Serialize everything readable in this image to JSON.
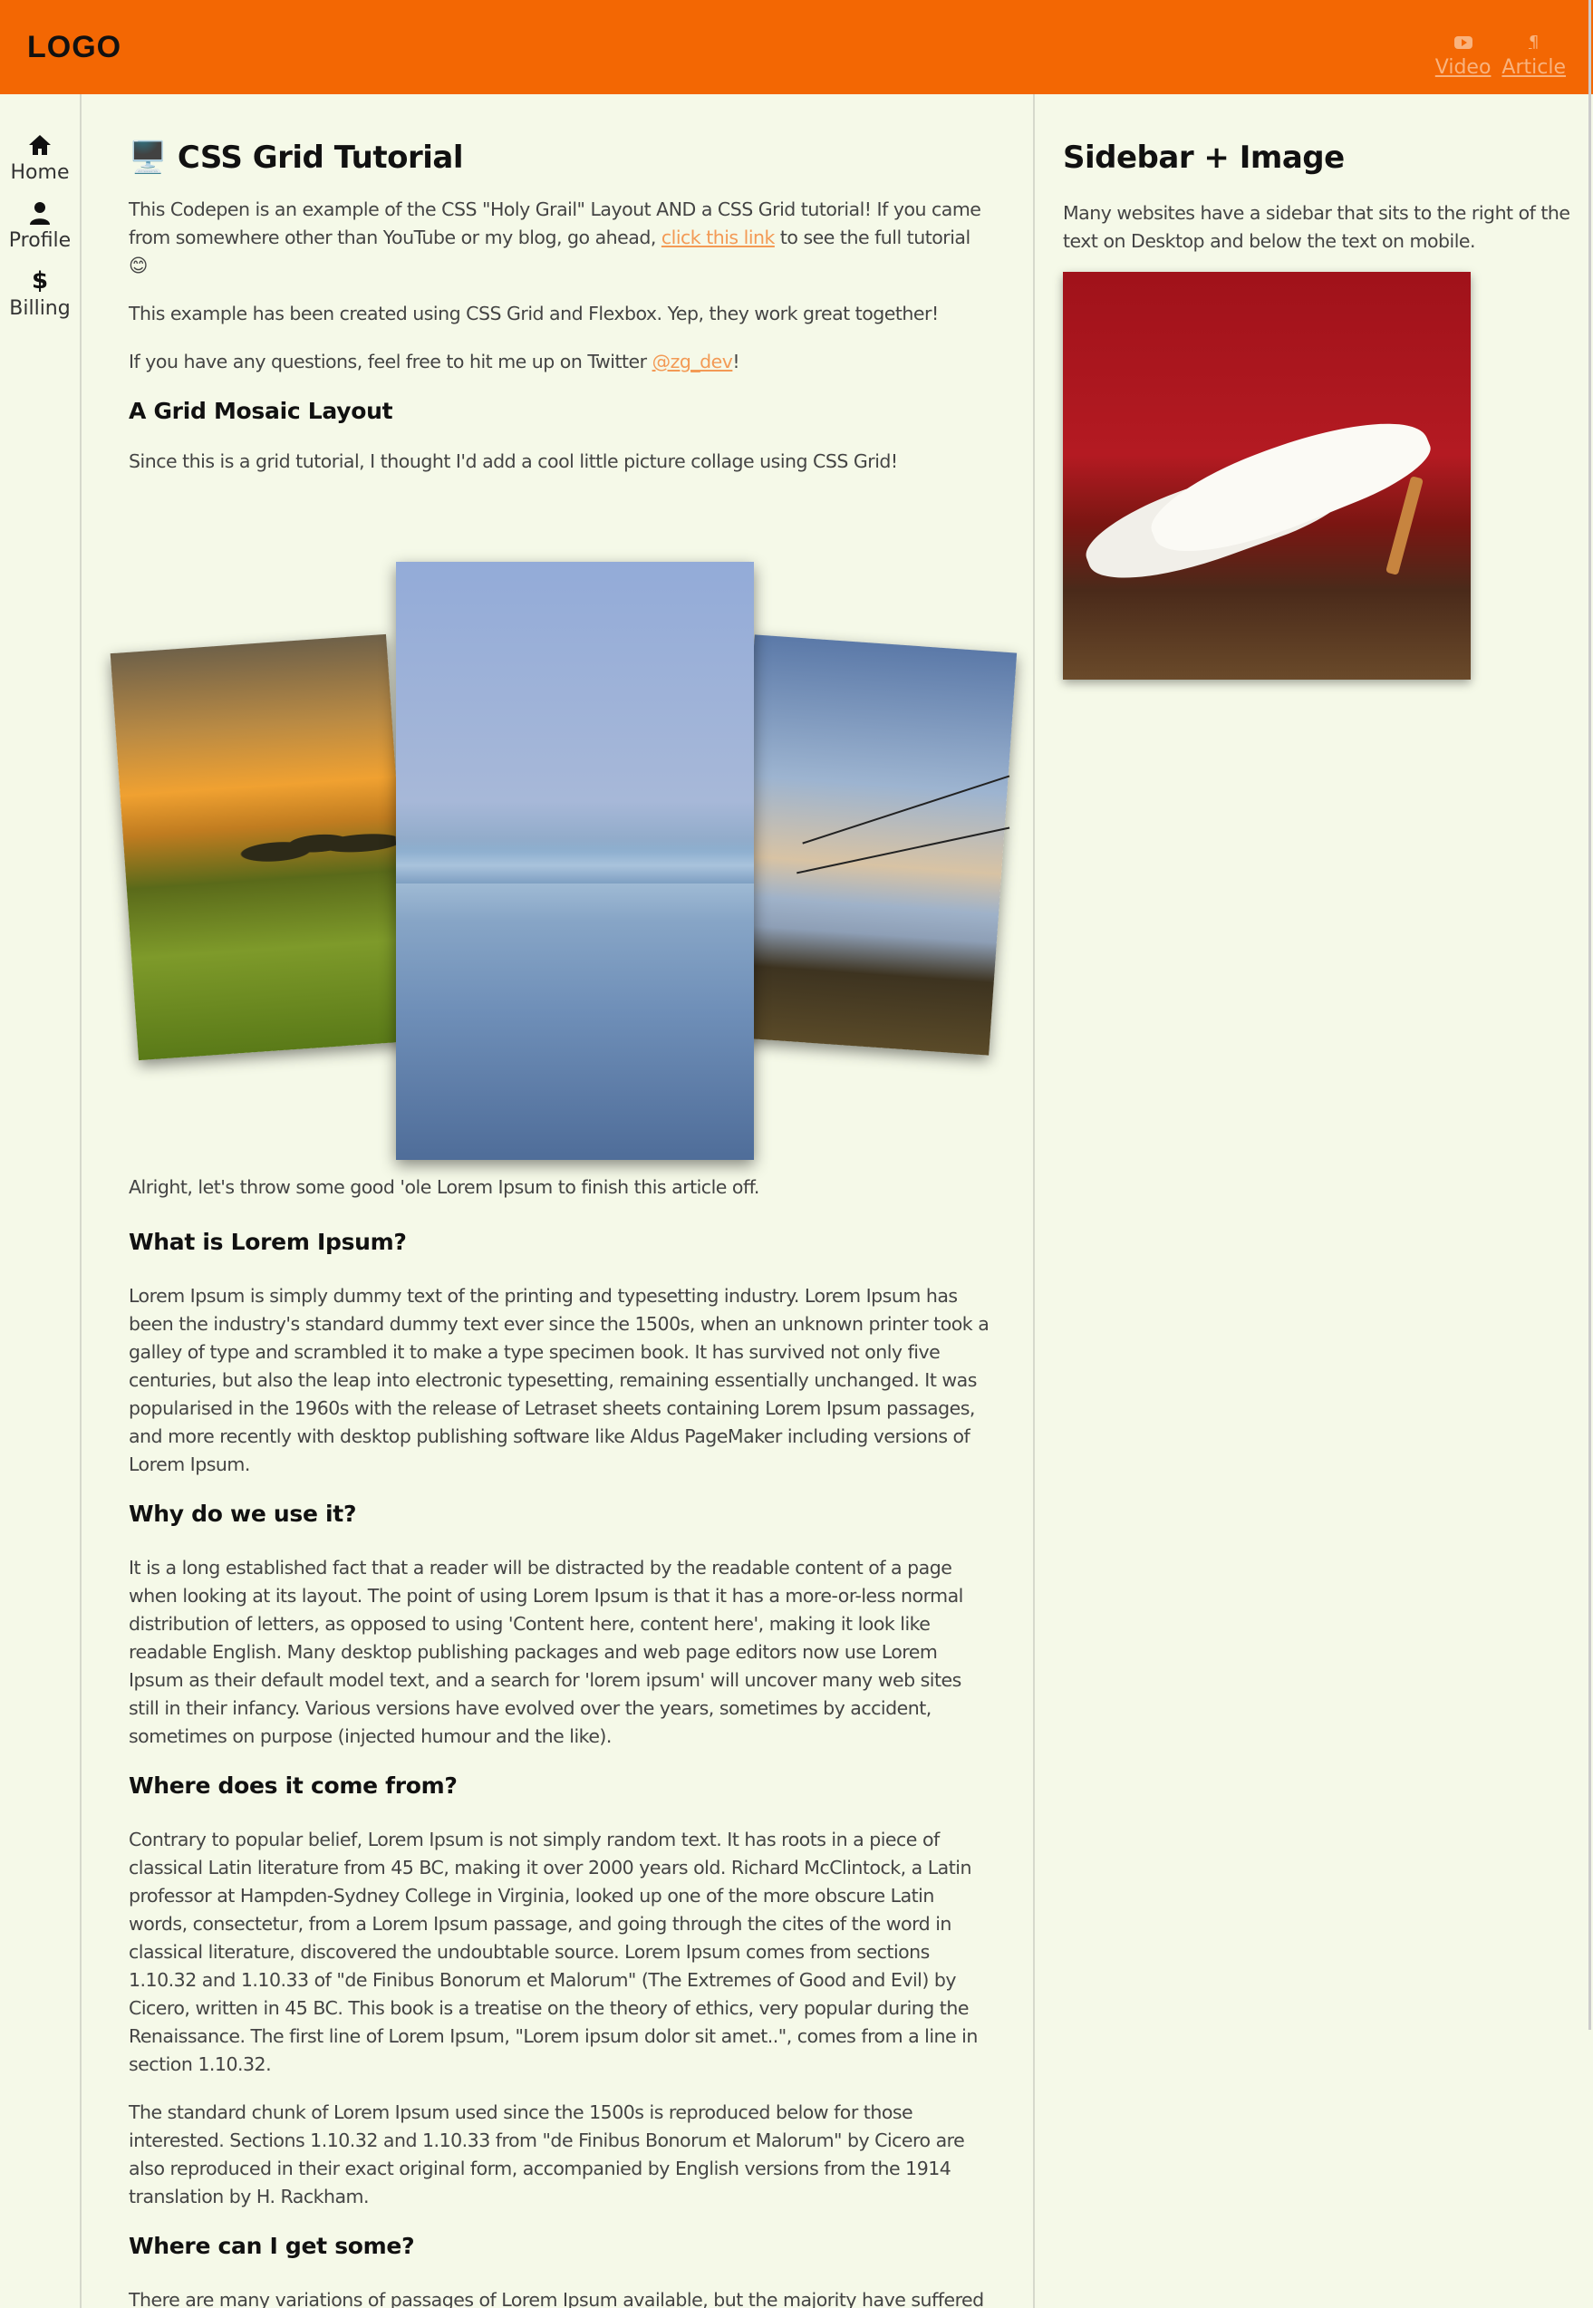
{
  "header": {
    "logo": "LOGO",
    "nav": [
      {
        "label": "Video",
        "icon": "youtube-icon"
      },
      {
        "label": "Article",
        "icon": "paragraph-icon"
      }
    ]
  },
  "leftnav": [
    {
      "label": "Home",
      "icon": "home-icon"
    },
    {
      "label": "Profile",
      "icon": "user-icon"
    },
    {
      "label": "Billing",
      "icon": "dollar-icon"
    }
  ],
  "main": {
    "title_emoji": "🖥️",
    "title": "CSS Grid Tutorial",
    "intro_p1_before": "This Codepen is an example of the CSS \"Holy Grail\" Layout AND a CSS Grid tutorial! If you came from somewhere other than YouTube or my blog, go ahead, ",
    "intro_p1_link": "click this link",
    "intro_p1_after": " to see the full tutorial 😊",
    "intro_p2": "This example has been created using CSS Grid and Flexbox. Yep, they work great together!",
    "intro_p3_before": "If you have any questions, feel free to hit me up on Twitter ",
    "intro_p3_link": "@zg_dev",
    "intro_p3_after": "!",
    "mosaic_heading": "A Grid Mosaic Layout",
    "mosaic_p": "Since this is a grid tutorial, I thought I'd add a cool little picture collage using CSS Grid!",
    "after_mosaic_p": "Alright, let's throw some good 'ole Lorem Ipsum to finish this article off.",
    "sections": [
      {
        "heading": "What is Lorem Ipsum?",
        "paragraphs": [
          "Lorem Ipsum is simply dummy text of the printing and typesetting industry. Lorem Ipsum has been the industry's standard dummy text ever since the 1500s, when an unknown printer took a galley of type and scrambled it to make a type specimen book. It has survived not only five centuries, but also the leap into electronic typesetting, remaining essentially unchanged. It was popularised in the 1960s with the release of Letraset sheets containing Lorem Ipsum passages, and more recently with desktop publishing software like Aldus PageMaker including versions of Lorem Ipsum."
        ]
      },
      {
        "heading": "Why do we use it?",
        "paragraphs": [
          "It is a long established fact that a reader will be distracted by the readable content of a page when looking at its layout. The point of using Lorem Ipsum is that it has a more-or-less normal distribution of letters, as opposed to using 'Content here, content here', making it look like readable English. Many desktop publishing packages and web page editors now use Lorem Ipsum as their default model text, and a search for 'lorem ipsum' will uncover many web sites still in their infancy. Various versions have evolved over the years, sometimes by accident, sometimes on purpose (injected humour and the like)."
        ]
      },
      {
        "heading": "Where does it come from?",
        "paragraphs": [
          "Contrary to popular belief, Lorem Ipsum is not simply random text. It has roots in a piece of classical Latin literature from 45 BC, making it over 2000 years old. Richard McClintock, a Latin professor at Hampden-Sydney College in Virginia, looked up one of the more obscure Latin words, consectetur, from a Lorem Ipsum passage, and going through the cites of the word in classical literature, discovered the undoubtable source. Lorem Ipsum comes from sections 1.10.32 and 1.10.33 of \"de Finibus Bonorum et Malorum\" (The Extremes of Good and Evil) by Cicero, written in 45 BC. This book is a treatise on the theory of ethics, very popular during the Renaissance. The first line of Lorem Ipsum, \"Lorem ipsum dolor sit amet..\", comes from a line in section 1.10.32.",
          "The standard chunk of Lorem Ipsum used since the 1500s is reproduced below for those interested. Sections 1.10.32 and 1.10.33 from \"de Finibus Bonorum et Malorum\" by Cicero are also reproduced in their exact original form, accompanied by English versions from the 1914 translation by H. Rackham."
        ]
      },
      {
        "heading": "Where can I get some?",
        "paragraphs": [
          "There are many variations of passages of Lorem Ipsum available, but the majority have suffered alteration in some form, by injected humour, or randomised words which don't look even slightly"
        ]
      }
    ]
  },
  "sidebar": {
    "title": "Sidebar + Image",
    "text": "Many websites have a sidebar that sits to the right of the text on Desktop and below the text on mobile."
  },
  "colors": {
    "header_bg": "#f36703",
    "page_bg": "#f5f9e8",
    "link": "#f39a55"
  }
}
